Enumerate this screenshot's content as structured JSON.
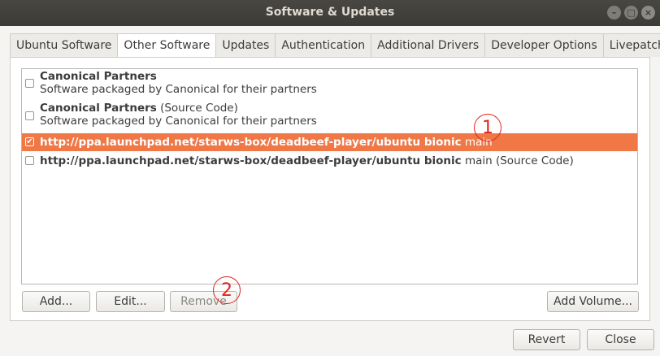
{
  "window": {
    "title": "Software & Updates",
    "controls": {
      "minimize": "–",
      "maximize": "□",
      "close": "×"
    }
  },
  "tabs": [
    {
      "label": "Ubuntu Software",
      "active": false
    },
    {
      "label": "Other Software",
      "active": true
    },
    {
      "label": "Updates",
      "active": false
    },
    {
      "label": "Authentication",
      "active": false
    },
    {
      "label": "Additional Drivers",
      "active": false
    },
    {
      "label": "Developer Options",
      "active": false
    },
    {
      "label": "Livepatch",
      "active": false
    }
  ],
  "sources": [
    {
      "title": "Canonical Partners",
      "suffix": "",
      "description": "Software packaged by Canonical for their partners",
      "checked": false,
      "selected": false
    },
    {
      "title": "Canonical Partners",
      "suffix": " (Source Code)",
      "description": "Software packaged by Canonical for their partners",
      "checked": false,
      "selected": false
    },
    {
      "title": "http://ppa.launchpad.net/starws-box/deadbeef-player/ubuntu bionic",
      "suffix": " main",
      "description": "",
      "checked": true,
      "selected": true
    },
    {
      "title": "http://ppa.launchpad.net/starws-box/deadbeef-player/ubuntu bionic",
      "suffix": " main (Source Code)",
      "description": "",
      "checked": false,
      "selected": false
    }
  ],
  "checkmark": "✔",
  "buttons": {
    "add": "Add...",
    "edit": "Edit...",
    "remove": "Remove",
    "add_volume": "Add Volume...",
    "revert": "Revert",
    "close": "Close"
  },
  "annotations": {
    "one": "1",
    "two": "2"
  },
  "colors": {
    "selection": "#f07746",
    "titlebar": "#3d3b37",
    "annotation": "#e2231a"
  }
}
